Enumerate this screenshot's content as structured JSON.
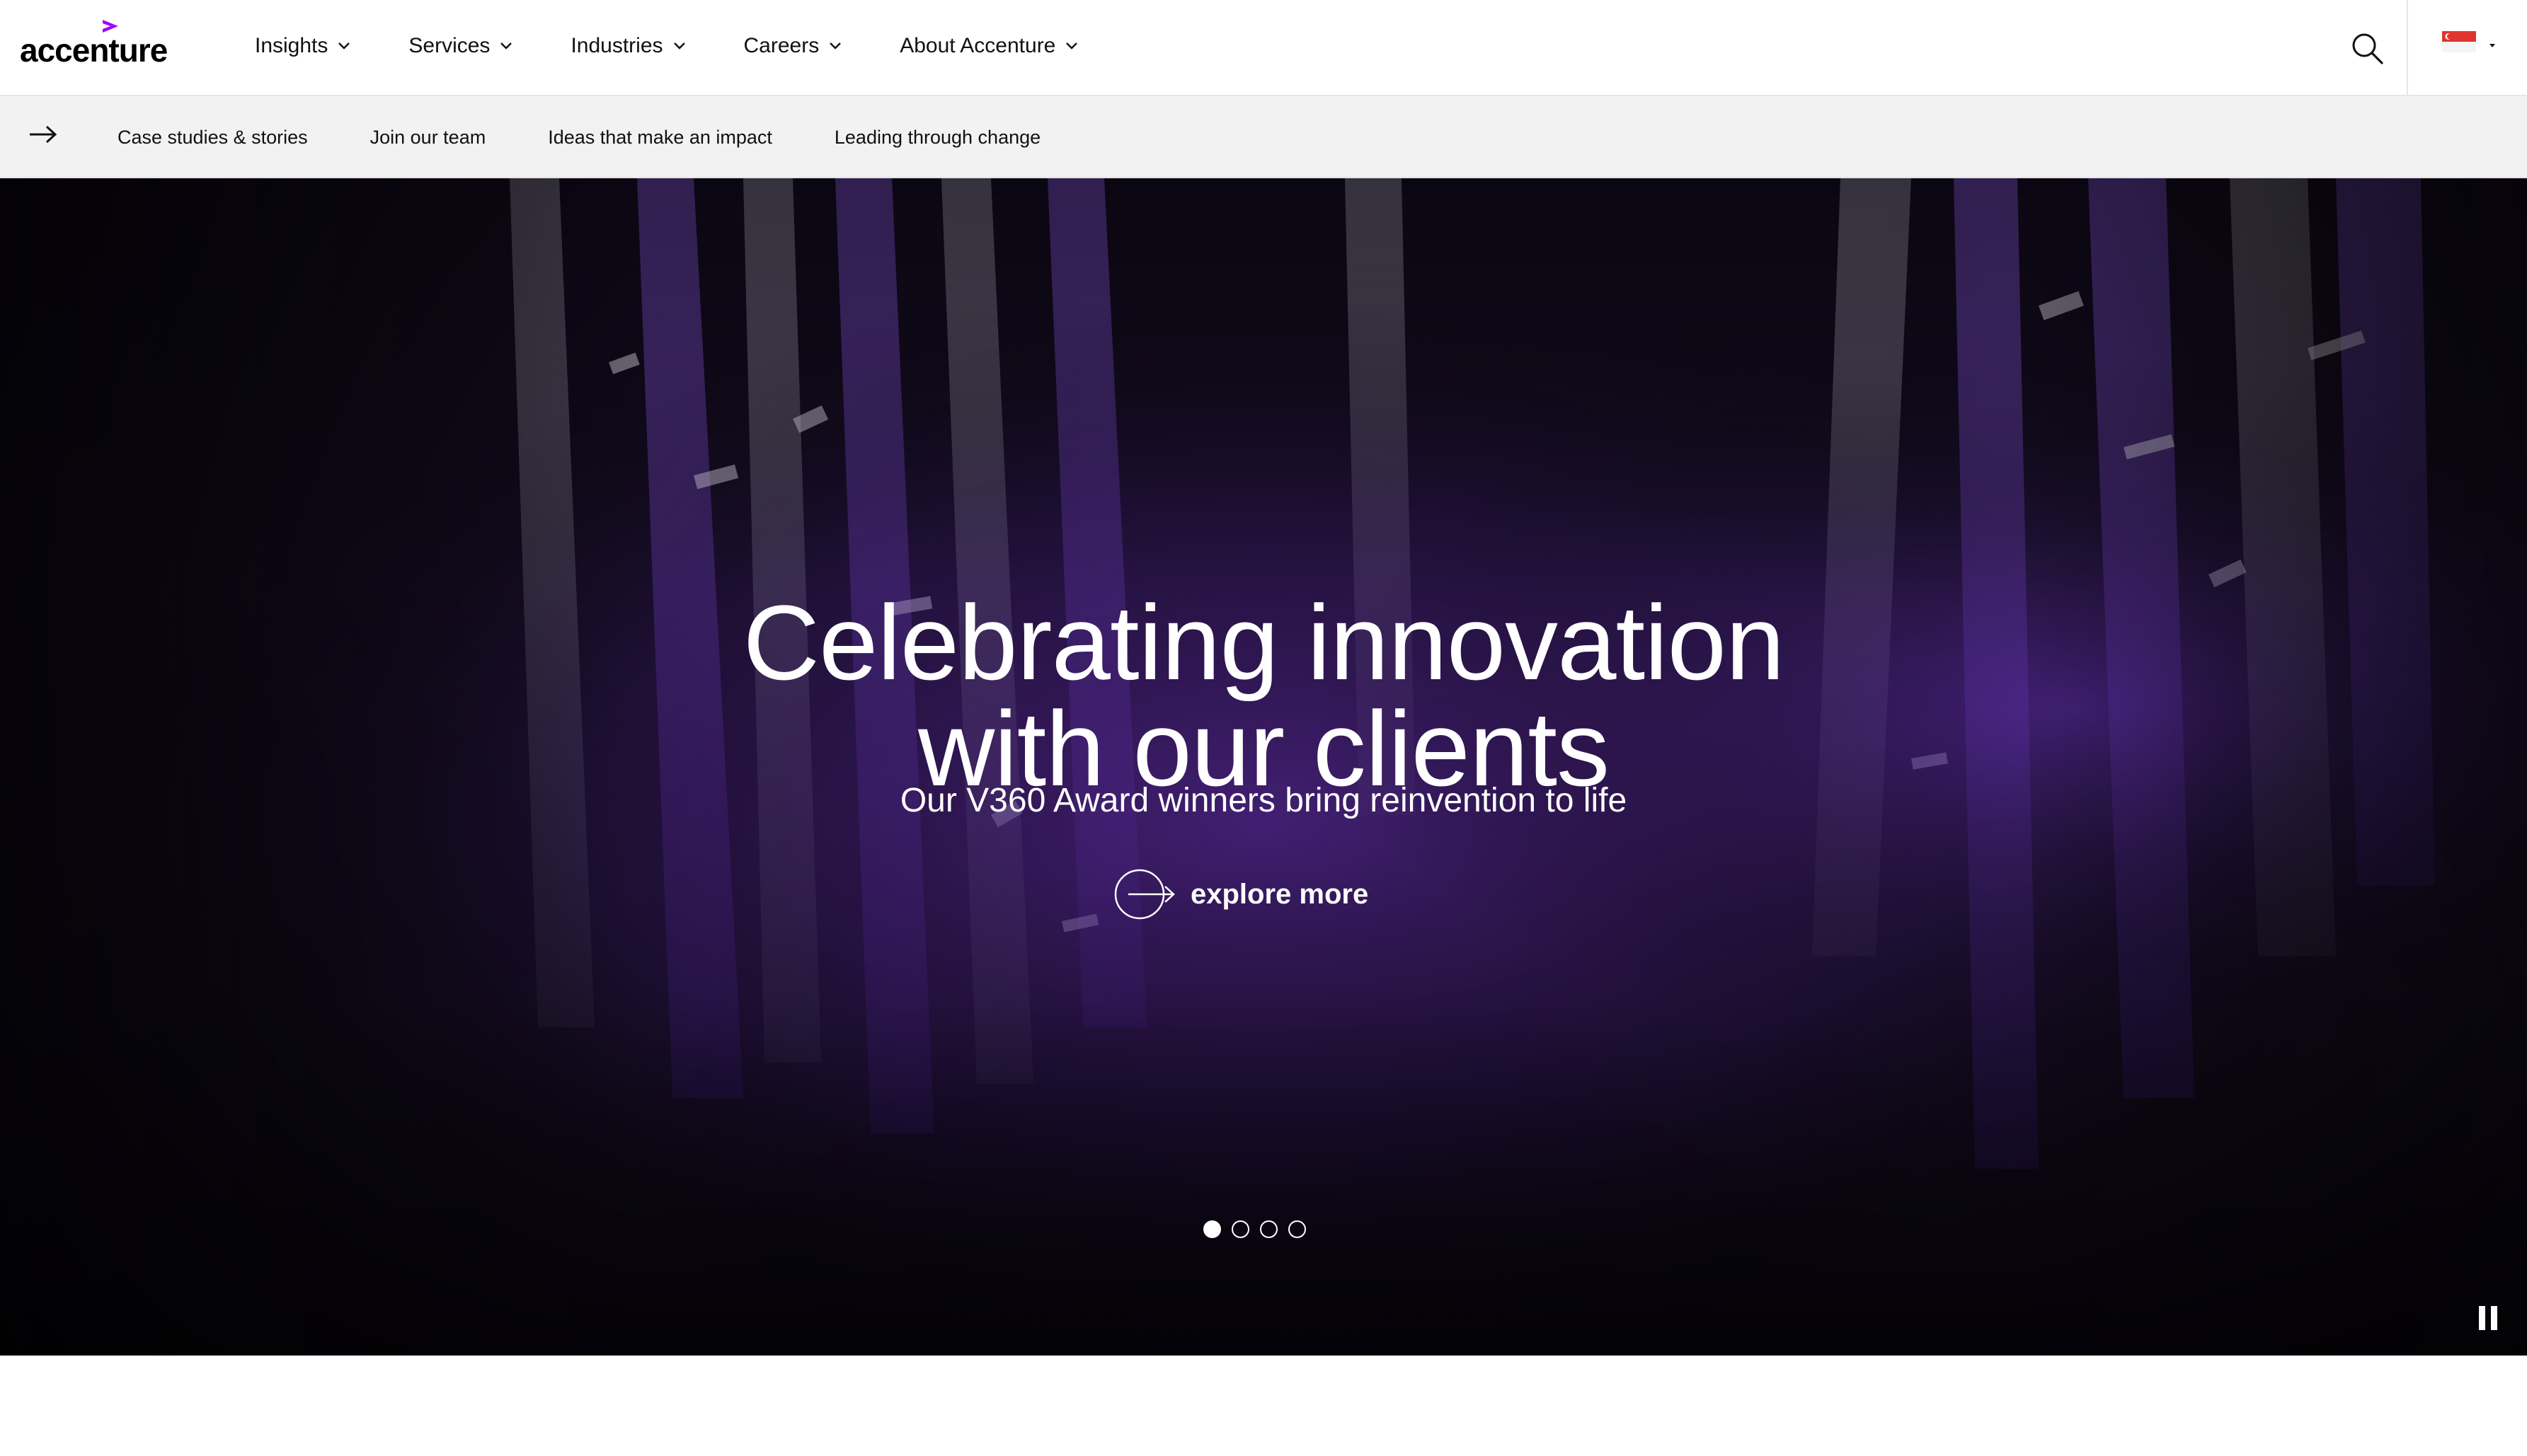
{
  "header": {
    "logo_text": "accenture",
    "brand_color": "#a100ff",
    "nav": [
      {
        "label": "Insights"
      },
      {
        "label": "Services"
      },
      {
        "label": "Industries"
      },
      {
        "label": "Careers"
      },
      {
        "label": "About Accenture"
      }
    ],
    "search_icon": "search-icon",
    "country_icon": "singapore-flag-icon"
  },
  "subnav": {
    "arrow_icon": "arrow-right-icon",
    "items": [
      {
        "label": "Case studies & stories"
      },
      {
        "label": "Join our team"
      },
      {
        "label": "Ideas that make an impact"
      },
      {
        "label": "Leading through change"
      }
    ]
  },
  "hero": {
    "title_line1": "Celebrating innovation",
    "title_line2": "with our clients",
    "subtitle": "Our V360 Award winners bring reinvention to life",
    "cta_label": "explore more",
    "cta_icon": "circle-arrow-right-icon",
    "slides": {
      "total": 4,
      "active": 1
    },
    "pause_icon": "pause-icon",
    "accent_color": "#5a1fae"
  }
}
